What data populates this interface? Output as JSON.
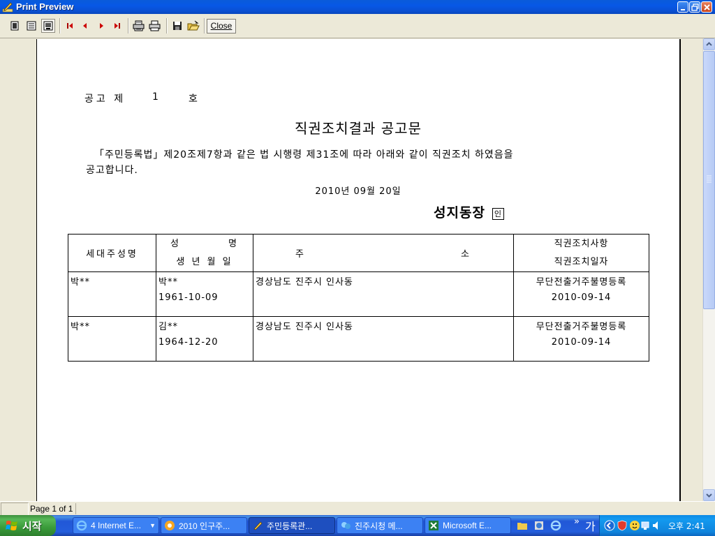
{
  "window": {
    "title": "Print Preview"
  },
  "toolbar": {
    "close_label": "Close",
    "buttons": [
      "one-page-icon",
      "multi-page-icon",
      "zoom-icon",
      "first-page-icon",
      "prev-page-icon",
      "next-page-icon",
      "last-page-icon",
      "print-setup-icon",
      "print-icon",
      "save-icon",
      "open-icon"
    ]
  },
  "document": {
    "notice_prefix": "공고 제",
    "notice_number": "1",
    "notice_suffix": "호",
    "title": "직권조치결과 공고문",
    "body_line1": "「주민등록법」제20조제7항과 같은 법 시행령 제31조에 따라 아래와 같이 직권조치 하였음을",
    "body_line2": "공고합니다.",
    "date": "2010년  09월  20일",
    "issuer": "성지동장",
    "seal": "인",
    "table": {
      "headers": {
        "householder": "세대주성명",
        "name_top": "성",
        "name_top_right": "명",
        "name_bottom": "생 년 월 일",
        "address_left": "주",
        "address_right": "소",
        "action_top": "직권조치사항",
        "action_bottom": "직권조치일자"
      },
      "rows": [
        {
          "householder": "박**",
          "name": "박**",
          "birth": "1961-10-09",
          "address": "경상남도 진주시 인사동",
          "action": "무단전출거주불명등록",
          "action_date": "2010-09-14"
        },
        {
          "householder": "박**",
          "name": "김**",
          "birth": "1964-12-20",
          "address": "경상남도 진주시 인사동",
          "action": "무단전출거주불명등록",
          "action_date": "2010-09-14"
        }
      ]
    }
  },
  "status": {
    "page_counter": "Page 1 of 1"
  },
  "taskbar": {
    "start_label": "시작",
    "tasks": [
      {
        "label": "4 Internet E...",
        "icon": "ie-icon"
      },
      {
        "label": "2010 인구주...",
        "icon": "browser-icon"
      },
      {
        "label": "주민등록관...",
        "icon": "pencil-app-icon"
      },
      {
        "label": "진주시청 메...",
        "icon": "messenger-icon"
      },
      {
        "label": "Microsoft E...",
        "icon": "excel-icon"
      }
    ],
    "quick_more": "»",
    "lang_indicator": "가",
    "clock": "오후 2:41"
  }
}
